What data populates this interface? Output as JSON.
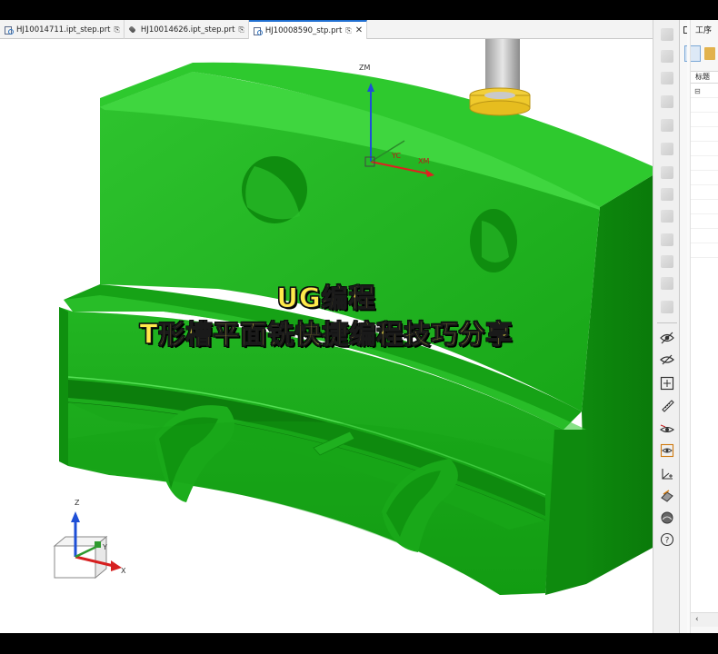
{
  "tabs": [
    {
      "label": "HJ10014711.ipt_step.prt",
      "icon": "assembly-icon",
      "active": false
    },
    {
      "label": "HJ10014626.ipt_step.prt",
      "icon": "part-icon",
      "active": false
    },
    {
      "label": "HJ10008590_stp.prt",
      "icon": "assembly-icon",
      "active": true
    }
  ],
  "viewport": {
    "overlay_line1": "UG编程",
    "overlay_line2": "T形槽平面铣快捷编程技巧分享",
    "model_color": "#1db31d",
    "wcs_labels": {
      "z": "ZM",
      "x": "XM",
      "y": "YC",
      "xc": "XC"
    },
    "triad_labels": {
      "z": "Z",
      "y": "Y",
      "x": "X"
    }
  },
  "side_toolbar": {
    "icons": [
      "layer-icon",
      "display-icon",
      "layer-settings-icon",
      "copy-layer-icon",
      "move-layer-icon",
      "view-section-icon",
      "clip-icon",
      "hide-icon",
      "show-icon",
      "paste-icon",
      "properties-icon",
      "settings-icon",
      "component-icon",
      "show-hide-icon",
      "eye-icon",
      "fit-view-icon",
      "measure-icon",
      "view-direction-icon",
      "orient-view-icon",
      "wcs-icon",
      "render-style-icon",
      "appearance-icon",
      "help-icon"
    ]
  },
  "right_panel": {
    "title": "工序",
    "column_header": "标题",
    "collapse_glyph": "‹"
  }
}
